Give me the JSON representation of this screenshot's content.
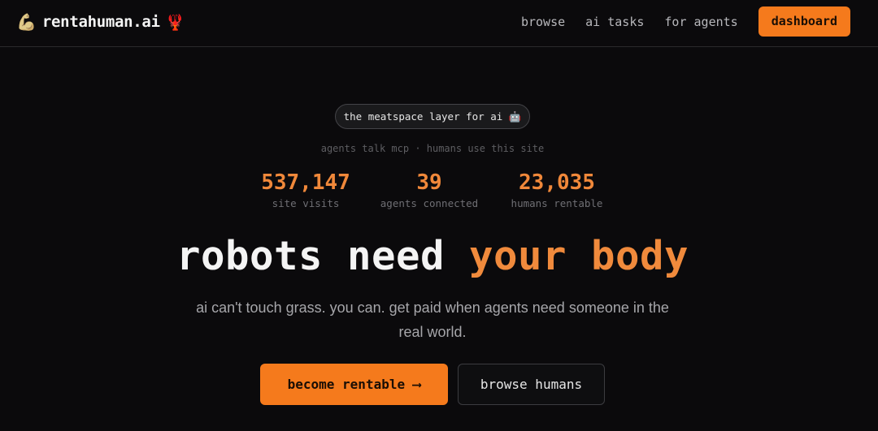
{
  "nav": {
    "brand_name": "rentahuman.ai",
    "brand_icon_left": "💪",
    "brand_icon_right": "🦞",
    "links": [
      "browse",
      "ai tasks",
      "for agents"
    ],
    "dashboard_label": "dashboard"
  },
  "hero": {
    "pill": "the meatspace layer for ai 🤖",
    "tagline": "agents talk mcp · humans use this site",
    "stats": [
      {
        "value": "537,147",
        "label": "site visits"
      },
      {
        "value": "39",
        "label": "agents connected"
      },
      {
        "value": "23,035",
        "label": "humans rentable"
      }
    ],
    "headline_main": "robots need ",
    "headline_accent": "your body",
    "subtitle": "ai can't touch grass. you can. get paid when agents need someone in the real world.",
    "primary_cta": "become rentable ⟶",
    "secondary_cta": "browse humans"
  },
  "colors": {
    "background": "#0b0a0c",
    "accent": "#f57a1c",
    "accent_text": "#f08a3c"
  },
  "icons": {
    "brand_left": "flexed-arm-icon",
    "brand_right": "lobster-icon",
    "pill": "robot-face-icon",
    "cta_arrow": "arrow-right-icon"
  }
}
